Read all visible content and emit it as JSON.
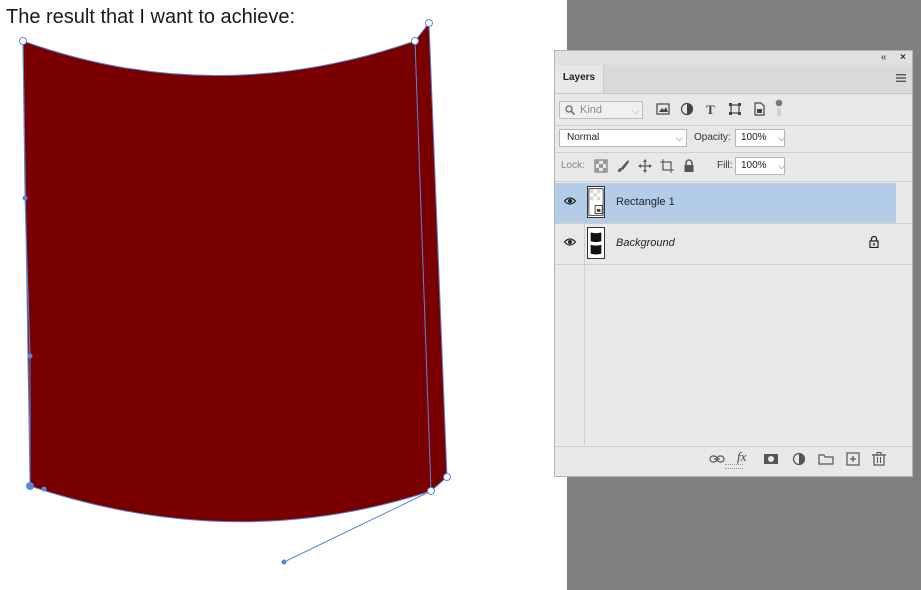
{
  "caption": "The result that I want to achieve:",
  "canvas": {
    "shape_color": "#7a0000",
    "path_color": "#5a86d8"
  },
  "panel": {
    "collapse_glyph": "«",
    "close_glyph": "×",
    "tab_label": "Layers",
    "filter": {
      "kind_placeholder": "Kind",
      "icons": [
        "image-filter-icon",
        "adjustment-filter-icon",
        "type-filter-icon",
        "shape-filter-icon",
        "smart-object-filter-icon",
        "filter-toggle-icon"
      ]
    },
    "blend_mode": "Normal",
    "opacity_label": "Opacity:",
    "opacity_value": "100%",
    "lock_label": "Lock:",
    "lock_icons": [
      "lock-transparent-icon",
      "lock-paint-icon",
      "lock-position-icon",
      "lock-artboard-icon",
      "lock-all-icon"
    ],
    "fill_label": "Fill:",
    "fill_value": "100%",
    "layers": [
      {
        "name": "Rectangle 1",
        "selected": true,
        "italic": false,
        "locked": false
      },
      {
        "name": "Background",
        "selected": false,
        "italic": true,
        "locked": true
      }
    ],
    "bottom_icons": [
      "link-layers-icon",
      "fx-icon",
      "mask-icon",
      "adjustment-layer-icon",
      "group-folder-icon",
      "new-layer-icon",
      "trash-icon"
    ],
    "fx_text": "fx"
  }
}
